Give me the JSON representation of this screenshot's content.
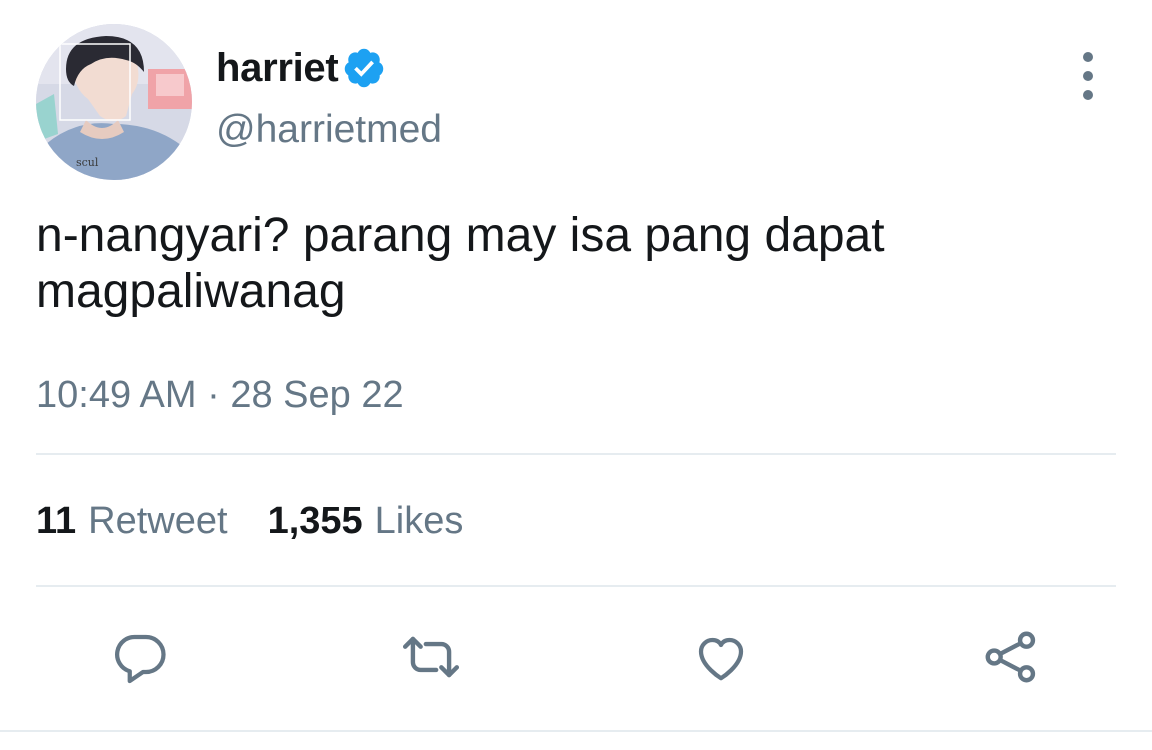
{
  "author": {
    "display_name": "harriet",
    "handle": "@harrietmed",
    "verified": true
  },
  "tweet": {
    "text": "n-nangyari? parang may isa pang dapat\nmagpaliwanag",
    "timestamp": "10:49 AM · 28 Sep 22"
  },
  "stats": {
    "retweets_count": "11",
    "retweets_label": "Retweet",
    "likes_count": "1,355",
    "likes_label": "Likes"
  },
  "icons": {
    "verified": "verified-badge-icon",
    "more": "more-vertical-icon",
    "reply": "reply-bubble-icon",
    "retweet": "retweet-icon",
    "like": "heart-icon",
    "share": "share-icon"
  },
  "colors": {
    "primary_text": "#14171a",
    "secondary_text": "#657786",
    "verified_blue": "#1da1f2",
    "divider": "#e6ecf0"
  }
}
